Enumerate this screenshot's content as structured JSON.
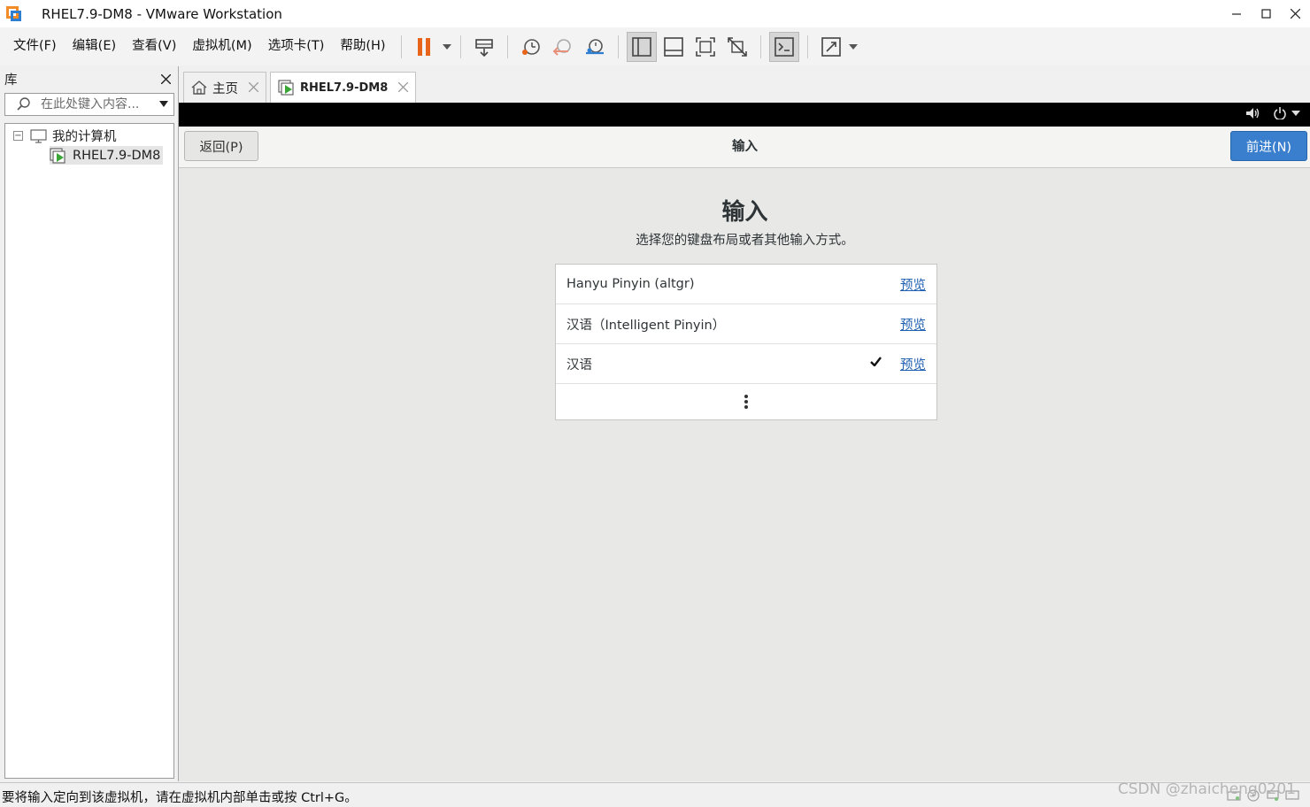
{
  "window": {
    "title": "RHEL7.9-DM8 - VMware Workstation",
    "controls": {
      "minimize": "—",
      "maximize": "☐",
      "close": "✕"
    }
  },
  "menu": [
    "文件(F)",
    "编辑(E)",
    "查看(V)",
    "虚拟机(M)",
    "选项卡(T)",
    "帮助(H)"
  ],
  "toolbar": {
    "icons": [
      "pause-icon",
      "send-ctrl-alt-del-icon",
      "snapshot-icon",
      "revert-snapshot-icon",
      "snapshot-manager-icon",
      "show-library-icon",
      "thumbnail-bar-icon",
      "full-screen-icon",
      "unity-icon",
      "console-icon",
      "stretch-icon"
    ],
    "pause_color": "#e8641b"
  },
  "library": {
    "title": "库",
    "close": "✕",
    "search_placeholder": "在此处键入内容...",
    "tree": {
      "root": {
        "toggle": "−",
        "label": "我的计算机"
      },
      "children": [
        {
          "label": "RHEL7.9-DM8"
        }
      ]
    }
  },
  "tabs": [
    {
      "label": "主页",
      "icon": "home-icon"
    },
    {
      "label": "RHEL7.9-DM8",
      "icon": "vm-icon"
    }
  ],
  "vm": {
    "header": {
      "back": "返回(P)",
      "title": "输入",
      "next": "前进(N)",
      "accent": "#3a7fcd"
    },
    "heading": "输入",
    "subtitle": "选择您的键盘布局或者其他输入方式。",
    "layouts": [
      {
        "name": "Hanyu Pinyin (altgr)",
        "preview": "预览",
        "selected": false
      },
      {
        "name": "汉语（Intelligent Pinyin）",
        "preview": "预览",
        "selected": false
      },
      {
        "name": "汉语",
        "preview": "预览",
        "selected": true
      }
    ],
    "more": "⋮"
  },
  "status": {
    "text": "要将输入定向到该虚拟机，请在虚拟机内部单击或按 Ctrl+G。",
    "watermark": "CSDN @zhaicheng0201"
  }
}
